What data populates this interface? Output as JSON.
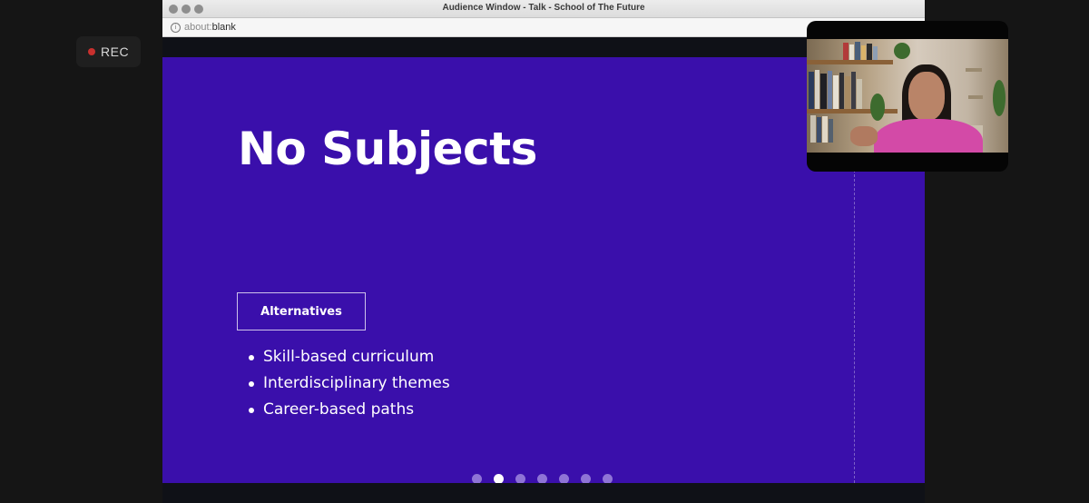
{
  "recording": {
    "label": "REC",
    "dot_color": "#c8302e"
  },
  "window": {
    "title": "Audience Window - Talk - School of The Future",
    "address": {
      "protocol": "about:",
      "path": "blank"
    }
  },
  "slide": {
    "background": "#3a0fab",
    "title": "No Subjects",
    "box_label": "Alternatives",
    "bullets": [
      "Skill-based curriculum",
      "Interdisciplinary themes",
      "Career-based paths"
    ],
    "pagination": {
      "total": 7,
      "current": 2
    }
  },
  "camera": {
    "subject": "speaker-video"
  }
}
